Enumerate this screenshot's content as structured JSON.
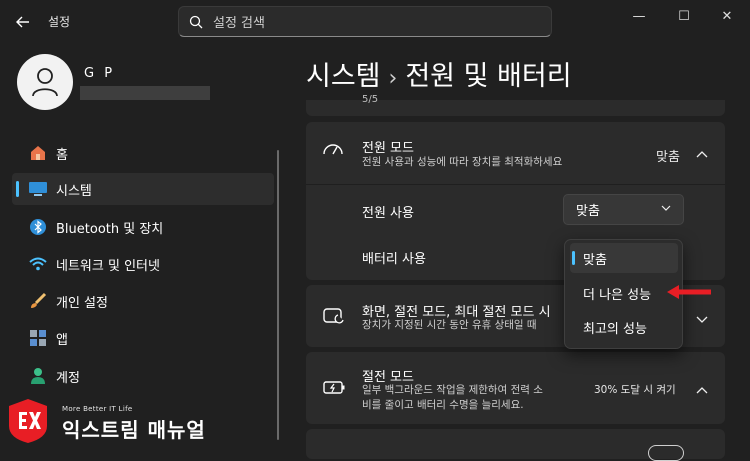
{
  "window": {
    "title": "설정",
    "search_placeholder": "설정 검색",
    "minimize": "—",
    "maximize": "☐",
    "close": "✕"
  },
  "profile": {
    "name": "G P"
  },
  "sidebar": {
    "items": [
      {
        "label": "홈",
        "icon": "home-icon"
      },
      {
        "label": "시스템",
        "icon": "system-icon",
        "active": true
      },
      {
        "label": "Bluetooth 및 장치",
        "icon": "bluetooth-icon"
      },
      {
        "label": "네트워크 및 인터넷",
        "icon": "wifi-icon"
      },
      {
        "label": "개인 설정",
        "icon": "brush-icon"
      },
      {
        "label": "앱",
        "icon": "apps-icon"
      },
      {
        "label": "계정",
        "icon": "account-icon"
      }
    ]
  },
  "breadcrumb": {
    "parent": "시스템",
    "separator": "›",
    "current": "전원 및 배터리"
  },
  "top_partial": "5/5",
  "power_mode": {
    "title": "전원 모드",
    "desc": "전원 사용과 성능에 따라 장치를 최적화하세요",
    "value": "맞춤",
    "plugged_label": "전원 사용",
    "plugged_value": "맞춤",
    "battery_label": "배터리 사용",
    "options": [
      "맞춤",
      "더 나은 성능",
      "최고의 성능"
    ]
  },
  "screen_card": {
    "title": "화면, 절전 모드, 최대 절전 모드 시",
    "desc": "장치가 지정된 시간 동안 유휴 상태일 때"
  },
  "saver_card": {
    "title": "절전 모드",
    "desc_line1": "일부 백그라운드 작업을 제한하여 전력 소",
    "desc_line2": "비를 줄이고 배터리 수명을 늘리세요.",
    "value": "30% 도달 시 켜기"
  },
  "logo": {
    "tagline": "More Better IT Life",
    "name": "익스트림 매뉴얼"
  },
  "colors": {
    "background": "#202020",
    "card": "#2b2b2b",
    "accent": "#4cc2ff",
    "annotation_arrow": "#e81e25"
  }
}
